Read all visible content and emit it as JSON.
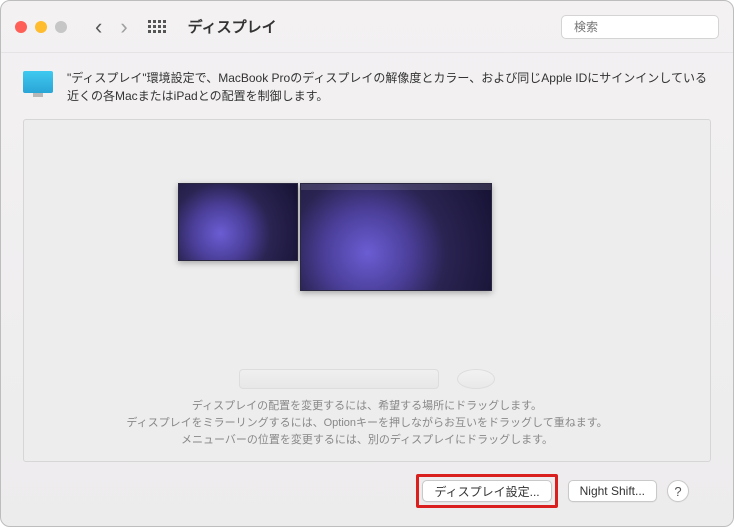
{
  "window": {
    "title": "ディスプレイ"
  },
  "search": {
    "placeholder": "検索"
  },
  "description": "\"ディスプレイ\"環境設定で、MacBook Proのディスプレイの解像度とカラー、および同じApple IDにサインインしている近くの各MacまたはiPadとの配置を制御します。",
  "hints": {
    "line1": "ディスプレイの配置を変更するには、希望する場所にドラッグします。",
    "line2": "ディスプレイをミラーリングするには、Optionキーを押しながらお互いをドラッグして重ねます。",
    "line3": "メニューバーの位置を変更するには、別のディスプレイにドラッグします。"
  },
  "buttons": {
    "display_settings": "ディスプレイ設定...",
    "night_shift": "Night Shift..."
  },
  "helpLabel": "?"
}
